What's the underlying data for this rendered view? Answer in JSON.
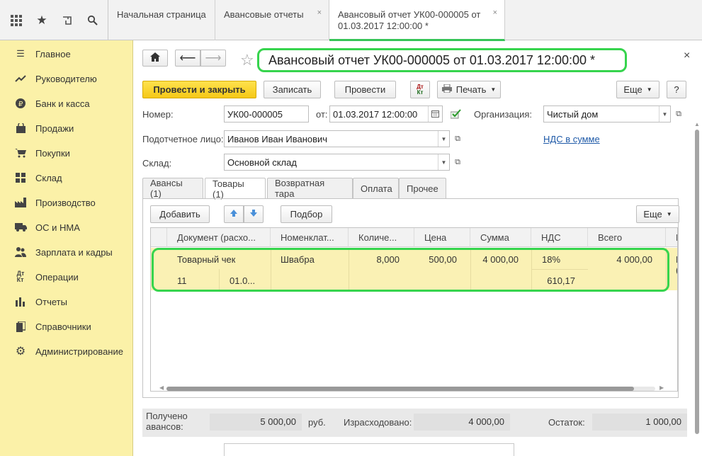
{
  "topbar": {
    "icons": [
      "apps-grid-icon",
      "favorites-star-icon",
      "history-icon",
      "search-icon"
    ],
    "tabs": [
      {
        "label": "Начальная страница"
      },
      {
        "label": "Авансовые отчеты",
        "close": "×"
      },
      {
        "label_line1": "Авансовый отчет УК00-000005 от",
        "label_line2": "01.03.2017 12:00:00 *",
        "close": "×",
        "active": true
      }
    ]
  },
  "sidebar": {
    "items": [
      {
        "label": "Главное",
        "icon": "menu-lines-icon"
      },
      {
        "label": "Руководителю",
        "icon": "trend-chart-icon"
      },
      {
        "label": "Банк и касса",
        "icon": "ruble-coin-icon"
      },
      {
        "label": "Продажи",
        "icon": "shopping-bag-icon"
      },
      {
        "label": "Покупки",
        "icon": "shopping-cart-icon"
      },
      {
        "label": "Склад",
        "icon": "warehouse-icon"
      },
      {
        "label": "Производство",
        "icon": "factory-icon"
      },
      {
        "label": "ОС и НМА",
        "icon": "truck-icon"
      },
      {
        "label": "Зарплата и кадры",
        "icon": "people-icon"
      },
      {
        "label": "Операции",
        "icon": "debit-credit-icon"
      },
      {
        "label": "Отчеты",
        "icon": "bar-chart-icon"
      },
      {
        "label": "Справочники",
        "icon": "books-icon"
      },
      {
        "label": "Администрирование",
        "icon": "gear-icon"
      }
    ]
  },
  "doc": {
    "title": "Авансовый отчет УК00-000005 от 01.03.2017 12:00:00 *",
    "close": "×",
    "toolbar": {
      "post_close": "Провести и закрыть",
      "save": "Записать",
      "post": "Провести",
      "dt_kt": "Дт Кт",
      "print": "Печать",
      "more": "Еще",
      "help": "?"
    },
    "fields": {
      "number_label": "Номер:",
      "number_value": "УК00-000005",
      "date_label": "от:",
      "date_value": "01.03.2017 12:00:00",
      "org_label": "Организация:",
      "org_value": "Чистый дом",
      "person_label": "Подотчетное лицо:",
      "person_value": "Иванов Иван Иванович",
      "vat_link": "НДС в сумме",
      "warehouse_label": "Склад:",
      "warehouse_value": "Основной склад"
    },
    "tabs": [
      "Авансы (1)",
      "Товары (1)",
      "Возвратная тара",
      "Оплата",
      "Прочее"
    ],
    "table_toolbar": {
      "add": "Добавить",
      "select": "Подбор",
      "more": "Еще"
    },
    "columns": [
      "Документ (расхо...",
      "Номенклат...",
      "Количе...",
      "Цена",
      "Сумма",
      "НДС",
      "Всего",
      "П"
    ],
    "row": {
      "doc": "Товарный чек",
      "doc_num": "11",
      "doc_date": "01.0...",
      "item": "Швабра",
      "qty": "8,000",
      "price": "500,00",
      "sum": "4 000,00",
      "vat_rate": "18%",
      "vat_sum": "610,17",
      "total": "4 000,00",
      "cut1": "П",
      "cut2": "("
    },
    "footer": {
      "received_label_1": "Получено",
      "received_label_2": "авансов:",
      "received_value": "5 000,00",
      "currency": "руб.",
      "spent_label": "Израсходовано:",
      "spent_value": "4 000,00",
      "balance_label": "Остаток:",
      "balance_value": "1 000,00"
    }
  },
  "colors": {
    "accent_green": "#36d44d",
    "sidebar_bg": "#fbf1a8",
    "primary_button": "#f5c816"
  }
}
